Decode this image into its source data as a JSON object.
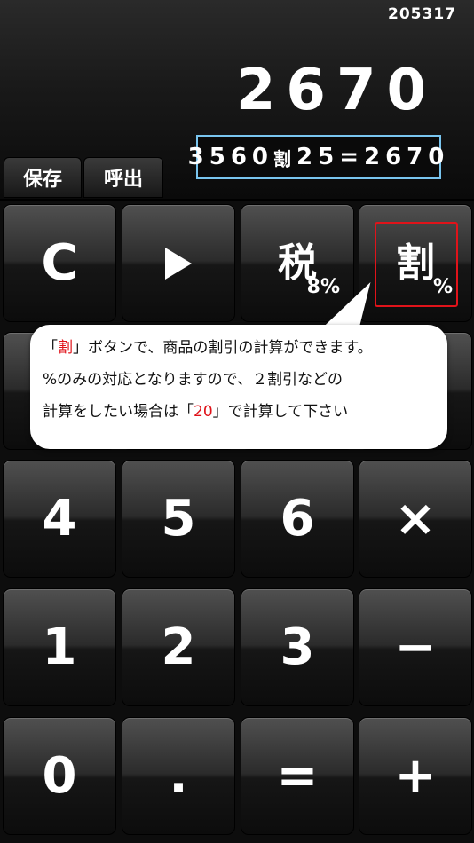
{
  "display": {
    "counter": "205317",
    "value": "2670",
    "expression_left": "3560",
    "expression_op": "割",
    "expression_op_sub": "%",
    "expression_right": "25=2670"
  },
  "memory": {
    "save_label": "保存",
    "recall_label": "呼出"
  },
  "keys": {
    "clear": "C",
    "tax_main": "税",
    "tax_sub": "8%",
    "discount_main": "割",
    "discount_sub": "%",
    "four": "4",
    "five": "5",
    "six": "6",
    "multiply": "×",
    "one": "1",
    "two": "2",
    "three": "3",
    "minus": "−",
    "zero": "0",
    "dot": ".",
    "equals": "=",
    "plus": "+"
  },
  "tooltip": {
    "l1_open": "「",
    "l1_red": "割",
    "l1_rest": "」ボタンで、商品の割引の計算ができます。",
    "l2": "%のみの対応となりますので、２割引などの",
    "l3_pre": "計算をしたい場合は「",
    "l3_red": "20",
    "l3_post": "」で計算して下さい"
  },
  "colors": {
    "accent_red": "#e0131a",
    "expr_border": "#79c5ef"
  }
}
